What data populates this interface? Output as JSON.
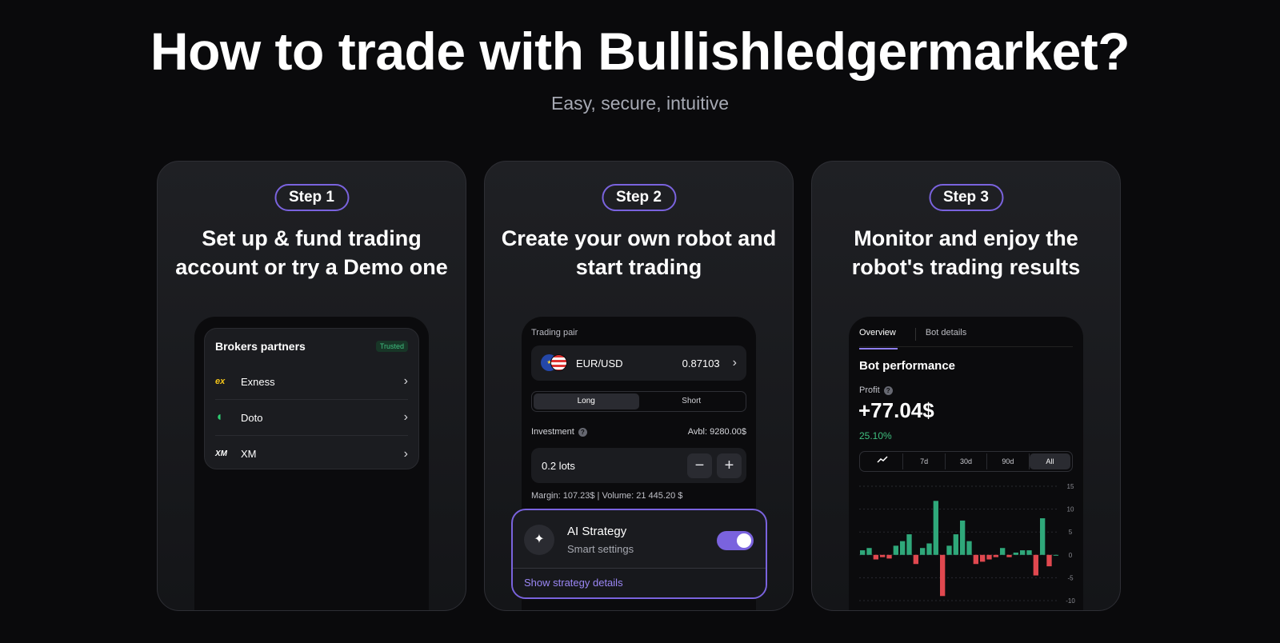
{
  "header": {
    "title": "How to trade with Bullishledgermarket?",
    "subtitle": "Easy, secure, intuitive"
  },
  "steps": [
    {
      "badge": "Step 1",
      "title": "Set up & fund trading account or try a Demo one"
    },
    {
      "badge": "Step 2",
      "title": "Create your own robot and start trading"
    },
    {
      "badge": "Step 3",
      "title": "Monitor and enjoy the robot's trading results"
    }
  ],
  "brokers": {
    "title": "Brokers partners",
    "badge": "Trusted",
    "items": [
      {
        "logo": "ex",
        "name": "Exness",
        "logo_color": "#f5c518"
      },
      {
        "logo": "◖",
        "name": "Doto",
        "logo_color": "#2ecc71"
      },
      {
        "logo": "XM",
        "name": "XM",
        "logo_color": "#ffffff"
      }
    ]
  },
  "trade": {
    "pair_label": "Trading pair",
    "pair": "EUR/USD",
    "price": "0.87103",
    "sides": [
      "Long",
      "Short"
    ],
    "investment_label": "Investment",
    "available": "Avbl: 9280.00$",
    "lots": "0.2 lots",
    "minus": "−",
    "plus": "+",
    "margin_info": "Margin: 107.23$ | Volume: 21 445.20 $",
    "ai_title": "AI Strategy",
    "ai_sub": "Smart settings",
    "ai_link": "Show strategy details",
    "ai_enabled": true
  },
  "monitor": {
    "tabs": [
      "Overview",
      "Bot details"
    ],
    "perf_title": "Bot performance",
    "profit_label": "Profit",
    "profit_value": "+77.04$",
    "profit_pct": "25.10%",
    "ranges": [
      "7d",
      "30d",
      "90d",
      "All"
    ],
    "active_range": "All"
  },
  "colors": {
    "accent": "#7a63de",
    "positive": "#2fa87a",
    "negative": "#e0484f"
  },
  "chart_data": {
    "type": "bar",
    "y_ticks": [
      "15",
      "10",
      "5",
      "0",
      "-5",
      "-10"
    ],
    "ylim": [
      -10,
      15
    ],
    "values": [
      1,
      1.5,
      -1,
      -0.5,
      -0.8,
      2,
      3,
      4.5,
      -2,
      1.5,
      2.5,
      11.8,
      -9,
      2,
      4.5,
      7.5,
      3,
      -2,
      -1.5,
      -1,
      -0.5,
      1.5,
      -0.5,
      0.5,
      1,
      1,
      -4.5,
      8,
      -2.5,
      0
    ]
  }
}
